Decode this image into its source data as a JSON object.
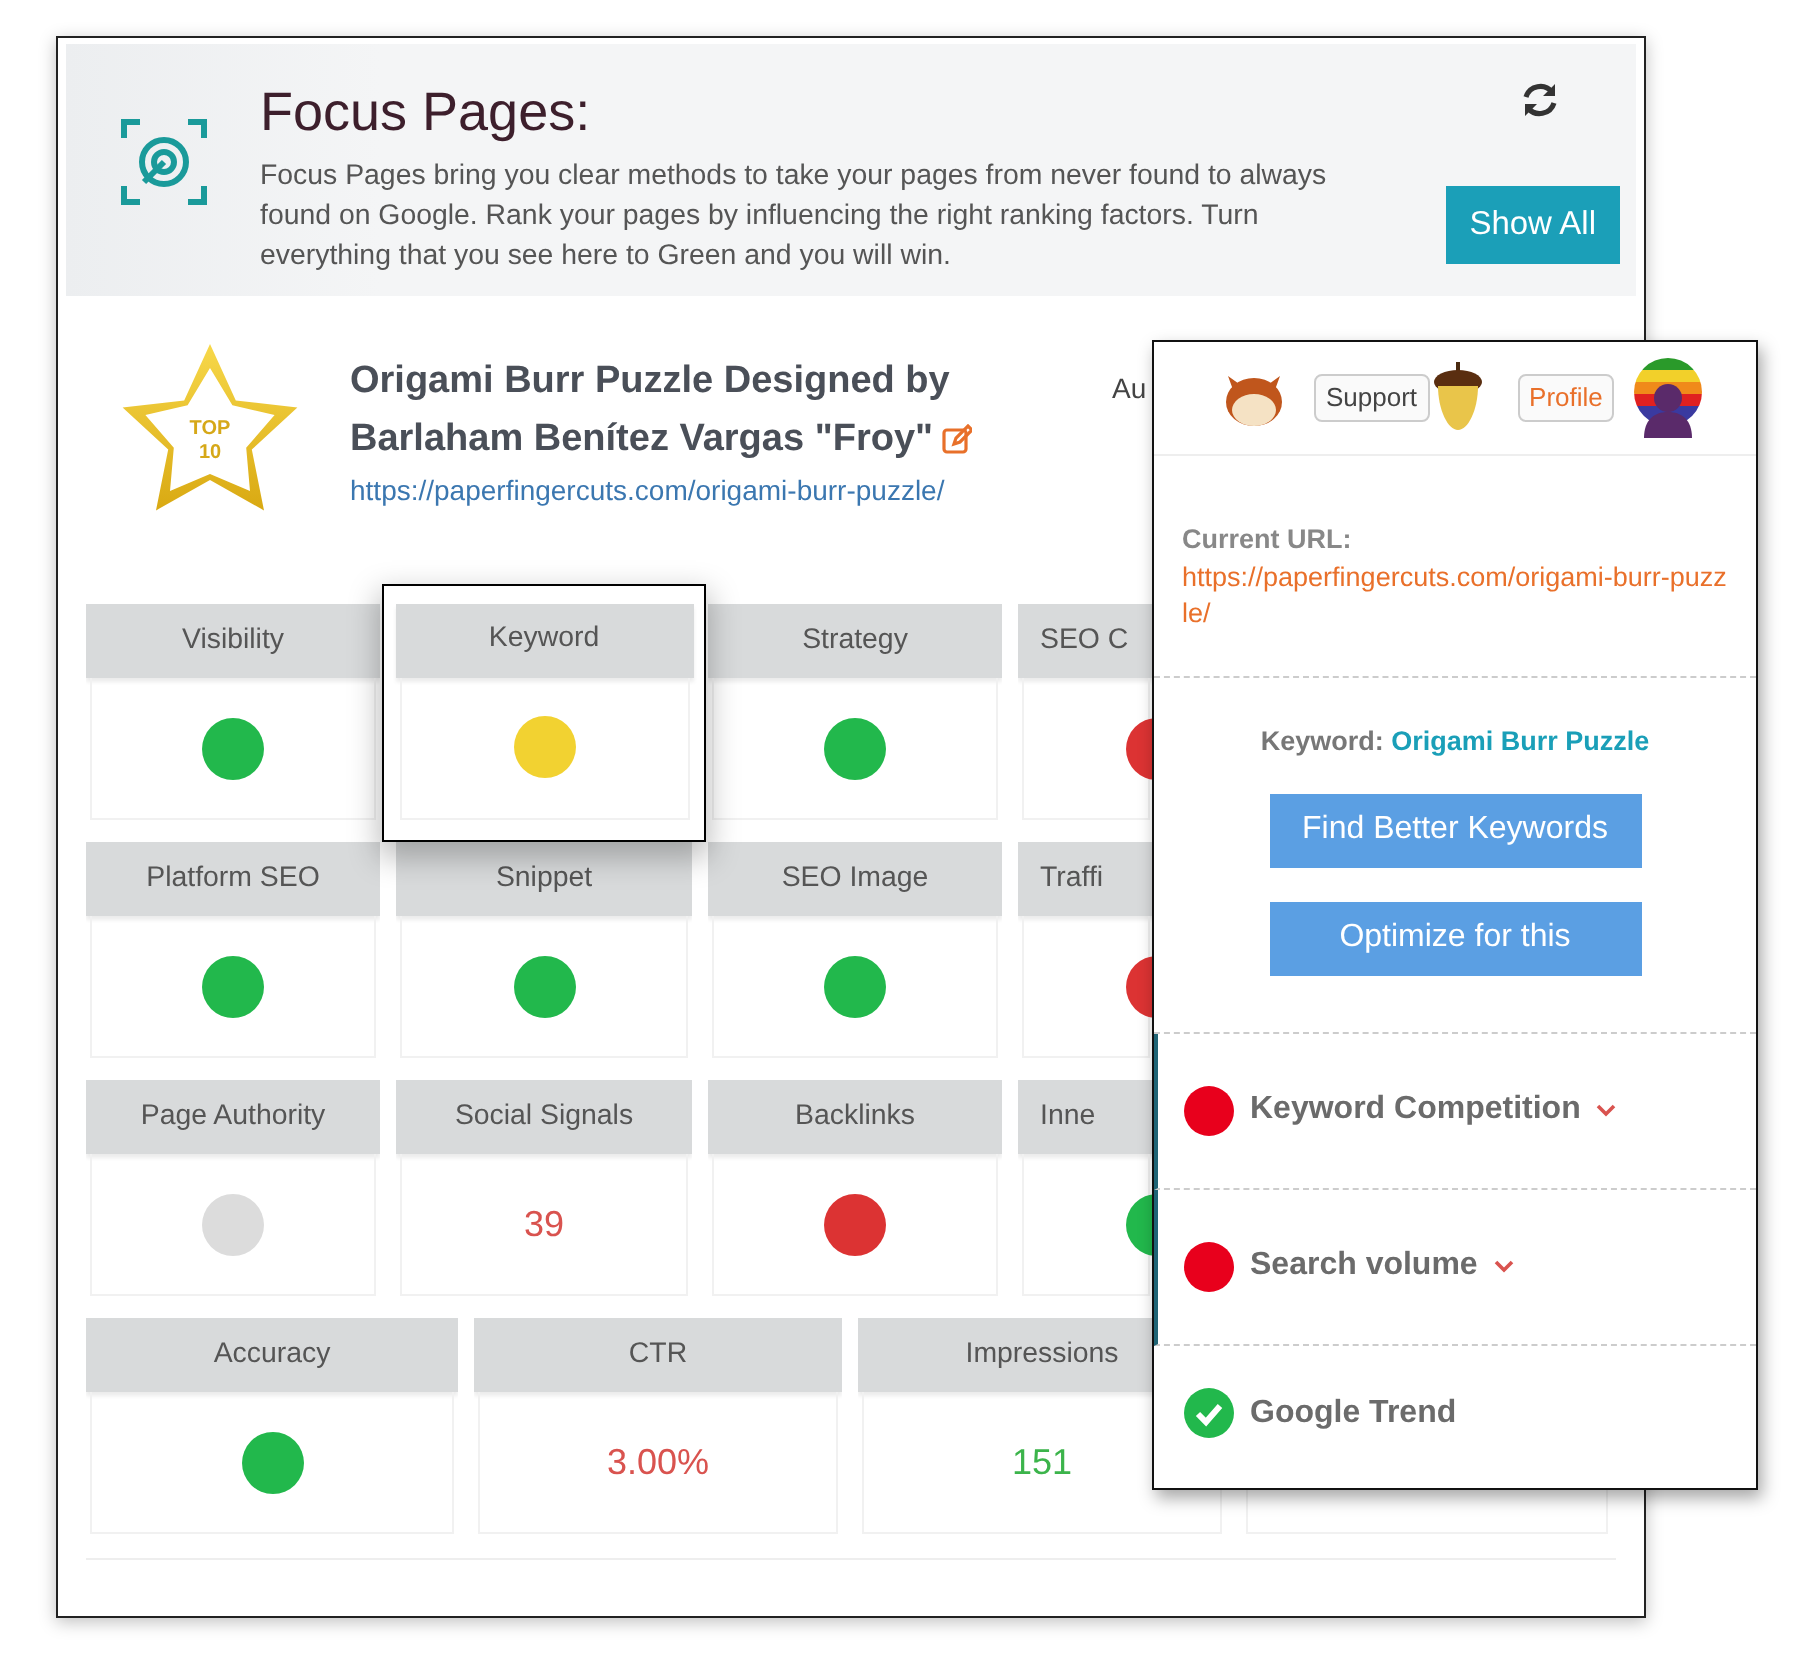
{
  "header": {
    "title": "Focus Pages:",
    "description": "Focus Pages bring you clear methods to take your pages from never found to always found on Google. Rank your pages by influencing the right ranking factors. Turn everything that you see here to Green and you will win.",
    "button": "Show All"
  },
  "page": {
    "badge": [
      "TOP",
      "10"
    ],
    "title": "Origami Burr Puzzle Designed by Barlaham Benítez Vargas \"Froy\"",
    "url": "https://paperfingercuts.com/origami-burr-puzzle/",
    "side_label": "Au"
  },
  "metric_rows": [
    {
      "kind": "narrow",
      "tiles": [
        {
          "label": "Visibility",
          "kind": "dot",
          "color": "#22b84c",
          "highlighted": false
        },
        {
          "label": "Keyword",
          "kind": "dot",
          "color": "#f2d231",
          "highlighted": true
        },
        {
          "label": "Strategy",
          "kind": "dot",
          "color": "#22b84c",
          "highlighted": false
        },
        {
          "label": "SEO C",
          "kind": "dot",
          "color": "#dc3333",
          "highlighted": false
        }
      ]
    },
    {
      "kind": "narrow",
      "tiles": [
        {
          "label": "Platform SEO",
          "kind": "dot",
          "color": "#22b84c",
          "highlighted": false
        },
        {
          "label": "Snippet",
          "kind": "dot",
          "color": "#22b84c",
          "highlighted": false
        },
        {
          "label": "SEO Image",
          "kind": "dot",
          "color": "#22b84c",
          "highlighted": false
        },
        {
          "label": "Traffi",
          "kind": "dot",
          "color": "#dc3333",
          "highlighted": false
        }
      ]
    },
    {
      "kind": "narrow",
      "tiles": [
        {
          "label": "Page Authority",
          "kind": "dot",
          "color": "#dcdcdc",
          "highlighted": false
        },
        {
          "label": "Social Signals",
          "kind": "number",
          "value": "39",
          "color": "#d9534f",
          "highlighted": false
        },
        {
          "label": "Backlinks",
          "kind": "dot",
          "color": "#dc3333",
          "highlighted": false
        },
        {
          "label": "Inne",
          "kind": "dot",
          "color": "#22b84c",
          "highlighted": false
        }
      ]
    },
    {
      "kind": "wide",
      "tiles": [
        {
          "label": "Accuracy",
          "kind": "dot",
          "color": "#22b84c",
          "highlighted": false
        },
        {
          "label": "CTR",
          "kind": "number",
          "value": "3.00%",
          "color": "#d9534f",
          "highlighted": false
        },
        {
          "label": "Impressions",
          "kind": "number",
          "value": "151",
          "color": "#3cb44b",
          "highlighted": false
        },
        {
          "kind": "empty",
          "highlighted": false
        }
      ]
    }
  ],
  "popup": {
    "support_button": "Support",
    "profile_button": "Profile",
    "url_label": "Current URL:",
    "url": "https://paperfingercuts.com/origami-burr-puzzle/",
    "keyword_label": "Keyword:",
    "keyword": "Origami Burr Puzzle",
    "buttons": [
      "Find Better Keywords",
      "Optimize for this"
    ],
    "checks": [
      {
        "label": "Keyword Competition",
        "kind": "dropdown",
        "color": "#e8001c"
      },
      {
        "label": "Search volume",
        "kind": "dropdown",
        "color": "#e8001c"
      },
      {
        "label": "Google Trend",
        "kind": "passed",
        "color": "#22b84c"
      }
    ]
  }
}
